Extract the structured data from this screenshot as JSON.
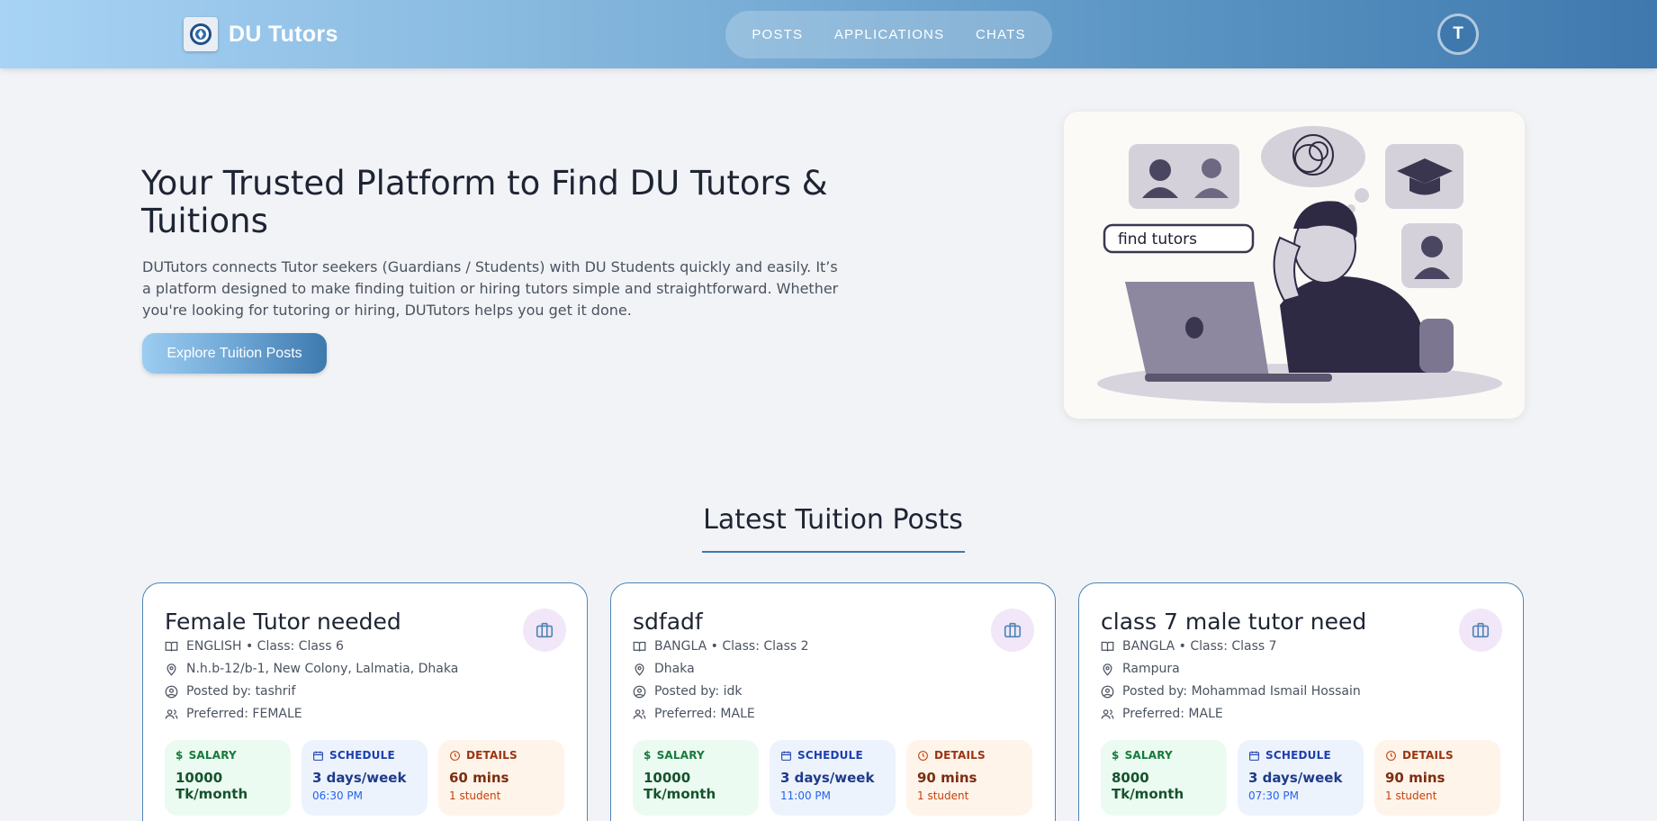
{
  "nav": {
    "brand": "DU Tutors",
    "links": [
      "POSTS",
      "APPLICATIONS",
      "CHATS"
    ],
    "avatar_initial": "T"
  },
  "hero": {
    "title": "Your Trusted Platform to Find DU Tutors & Tuitions",
    "description": "DUTutors connects Tutor seekers (Guardians / Students) with DU Students quickly and easily. It’s a platform designed to make finding tuition or hiring tutors simple and straightforward. Whether you're looking for tutoring or hiring, DUTutors helps you get it done.",
    "cta": "Explore Tuition Posts",
    "illustration_search_text": "find tutors"
  },
  "section": {
    "title": "Latest Tuition Posts"
  },
  "posts": [
    {
      "title": "Female Tutor needed",
      "subject_class": "ENGLISH • Class: Class 6",
      "location": "N.h.b-12/b-1, New Colony, Lalmatia, Dhaka",
      "posted_by": "Posted by: tashrif",
      "preferred": "Preferred: FEMALE",
      "salary_label": "SALARY",
      "salary": "10000 Tk/month",
      "schedule_label": "SCHEDULE",
      "schedule": "3 days/week",
      "time": "06:30 PM",
      "details_label": "DETAILS",
      "duration": "60 mins",
      "students": "1 student"
    },
    {
      "title": "sdfadf",
      "subject_class": "BANGLA • Class: Class 2",
      "location": "Dhaka",
      "posted_by": "Posted by: idk",
      "preferred": "Preferred: MALE",
      "salary_label": "SALARY",
      "salary": "10000 Tk/month",
      "schedule_label": "SCHEDULE",
      "schedule": "3 days/week",
      "time": "11:00 PM",
      "details_label": "DETAILS",
      "duration": "90 mins",
      "students": "1 student"
    },
    {
      "title": "class 7 male tutor need",
      "subject_class": "BANGLA • Class: Class 7",
      "location": "Rampura",
      "posted_by": "Posted by: Mohammad Ismail Hossain",
      "preferred": "Preferred: MALE",
      "salary_label": "SALARY",
      "salary": "8000 Tk/month",
      "schedule_label": "SCHEDULE",
      "schedule": "3 days/week",
      "time": "07:30 PM",
      "details_label": "DETAILS",
      "duration": "90 mins",
      "students": "1 student"
    }
  ],
  "icons": {
    "brand": "du-logo-icon",
    "subject": "book-icon",
    "location": "map-pin-icon",
    "poster": "user-circle-icon",
    "preferred": "users-icon",
    "badge": "briefcase-icon",
    "salary": "dollar-icon",
    "schedule": "calendar-icon",
    "details": "clock-icon"
  },
  "colors": {
    "primary": "#3f78ad",
    "card_border": "#4f84b6"
  }
}
